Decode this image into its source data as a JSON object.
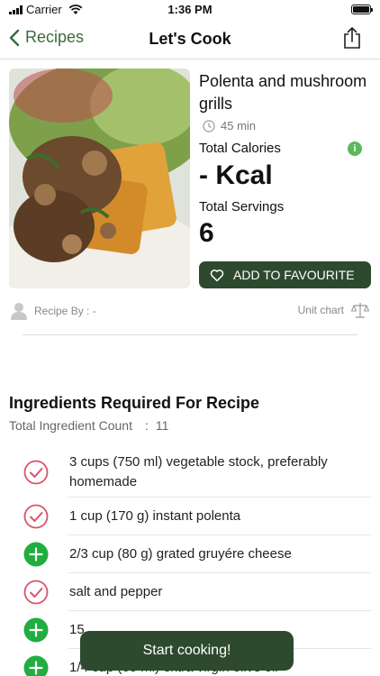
{
  "status_bar": {
    "carrier": "Carrier",
    "time": "1:36 PM"
  },
  "nav": {
    "back_label": "Recipes",
    "title": "Let's Cook",
    "share_icon": "share-icon"
  },
  "recipe": {
    "name": "Polenta and mushroom grills",
    "time": "45 min",
    "calories_label": "Total Calories",
    "calories_value": "- Kcal",
    "servings_label": "Total Servings",
    "servings_value": "6",
    "favourite_label": "ADD TO FAVOURITE",
    "recipe_by": "Recipe By : -",
    "unit_chart": "Unit chart"
  },
  "ingredients": {
    "heading": "Ingredients Required For Recipe",
    "count_label": "Total Ingredient Count",
    "count_sep": ":",
    "count_value": "11",
    "items": [
      {
        "text": "3 cups (750 ml) vegetable stock, preferably homemade",
        "status": "check"
      },
      {
        "text": "1 cup (170 g) instant polenta",
        "status": "check"
      },
      {
        "text": "2/3 cup (80 g) grated gruyére cheese",
        "status": "add"
      },
      {
        "text": "salt and pepper",
        "status": "check"
      },
      {
        "text": "15",
        "status": "add"
      },
      {
        "text": "1/4 cup (60 ml) extra virgin olive oil",
        "status": "add"
      }
    ]
  },
  "start_button": "Start cooking!",
  "colors": {
    "accent": "#3a6b3c",
    "button_bg": "#2d4a2f",
    "check": "#d9536b",
    "add": "#1fae3f",
    "info": "#5cb85c"
  }
}
